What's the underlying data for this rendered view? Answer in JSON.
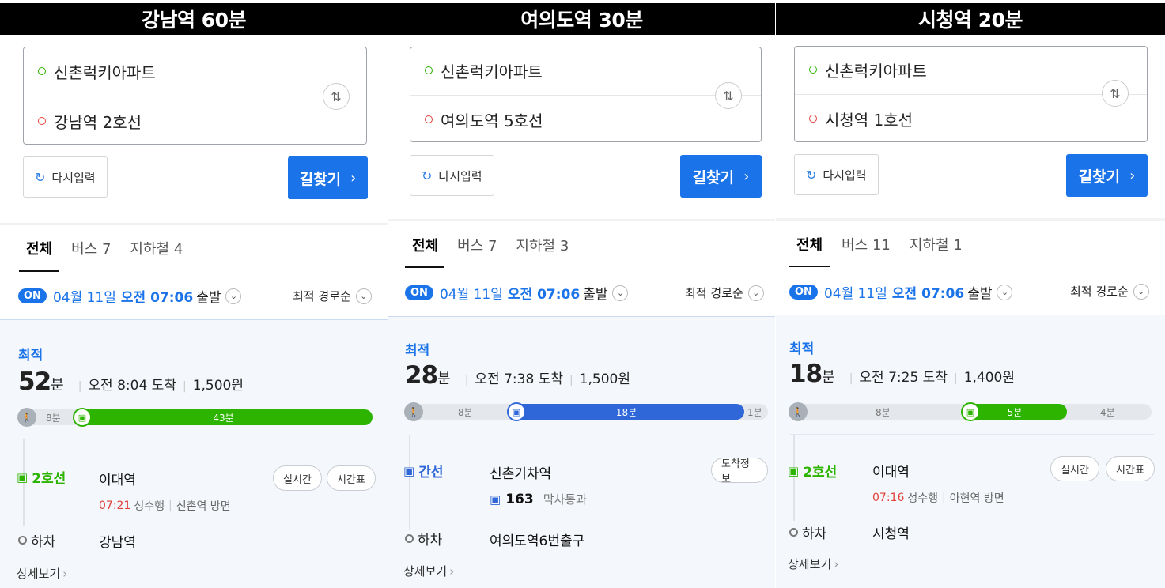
{
  "colors": {
    "accent_blue": "#1a73e8",
    "subway_green": "#2db400",
    "bus_blue": "#2f67d8",
    "time_red": "#e0413a"
  },
  "icons": {
    "origin": "green-circle-icon",
    "destination": "red-circle-icon",
    "swap": "swap-arrows-icon",
    "reset": "refresh-icon",
    "subway": "subway-icon",
    "bus": "bus-icon",
    "walk": "walk-icon"
  },
  "panels": [
    {
      "title": "강남역 60분",
      "origin": "신촌럭키아파트",
      "destination": "강남역 2호선",
      "reset_label": "다시입력",
      "route_label": "길찾기",
      "tabs": [
        "전체",
        "버스 7",
        "지하철 4"
      ],
      "on_badge": "ON",
      "depart_date": "04월 11일",
      "depart_time": "오전 07:06",
      "depart_suffix": "출발",
      "sort_label": "최적 경로순",
      "best_label": "최적",
      "duration": "52",
      "duration_unit": "분",
      "arrival": "오전 8:04 도착",
      "fare": "1,500원",
      "bar": {
        "walk_before": "8분",
        "main": "43분",
        "walk_after": "",
        "color": "green"
      },
      "line_label": "2호선",
      "board_station": "이대역",
      "pills": [
        "실시간",
        "시간표"
      ],
      "sub_time": "07:21",
      "sub_dest": "성수행",
      "sub_direction": "신촌역 방면",
      "bus_number": "",
      "bus_note": "",
      "getoff_label": "하차",
      "getoff_station": "강남역",
      "detail_label": "상세보기"
    },
    {
      "title": "여의도역 30분",
      "origin": "신촌럭키아파트",
      "destination": "여의도역 5호선",
      "reset_label": "다시입력",
      "route_label": "길찾기",
      "tabs": [
        "전체",
        "버스 7",
        "지하철 3"
      ],
      "on_badge": "ON",
      "depart_date": "04월 11일",
      "depart_time": "오전 07:06",
      "depart_suffix": "출발",
      "sort_label": "최적 경로순",
      "best_label": "최적",
      "duration": "28",
      "duration_unit": "분",
      "arrival": "오전 7:38 도착",
      "fare": "1,500원",
      "bar": {
        "walk_before": "8분",
        "main": "18분",
        "walk_after": "1분",
        "color": "blue"
      },
      "line_label": "간선",
      "board_station": "신촌기차역",
      "pills": [
        "도착정보"
      ],
      "sub_time": "",
      "sub_dest": "",
      "sub_direction": "",
      "bus_number": "163",
      "bus_note": "막차통과",
      "getoff_label": "하차",
      "getoff_station": "여의도역6번출구",
      "detail_label": "상세보기"
    },
    {
      "title": "시청역 20분",
      "origin": "신촌럭키아파트",
      "destination": "시청역 1호선",
      "reset_label": "다시입력",
      "route_label": "길찾기",
      "tabs": [
        "전체",
        "버스 11",
        "지하철 1"
      ],
      "on_badge": "ON",
      "depart_date": "04월 11일",
      "depart_time": "오전 07:06",
      "depart_suffix": "출발",
      "sort_label": "최적 경로순",
      "best_label": "최적",
      "duration": "18",
      "duration_unit": "분",
      "arrival": "오전 7:25 도착",
      "fare": "1,400원",
      "bar": {
        "walk_before": "8분",
        "main": "5분",
        "walk_after": "4분",
        "color": "green"
      },
      "line_label": "2호선",
      "board_station": "이대역",
      "pills": [
        "실시간",
        "시간표"
      ],
      "sub_time": "07:16",
      "sub_dest": "성수행",
      "sub_direction": "아현역 방면",
      "bus_number": "",
      "bus_note": "",
      "getoff_label": "하차",
      "getoff_station": "시청역",
      "detail_label": "상세보기"
    }
  ]
}
